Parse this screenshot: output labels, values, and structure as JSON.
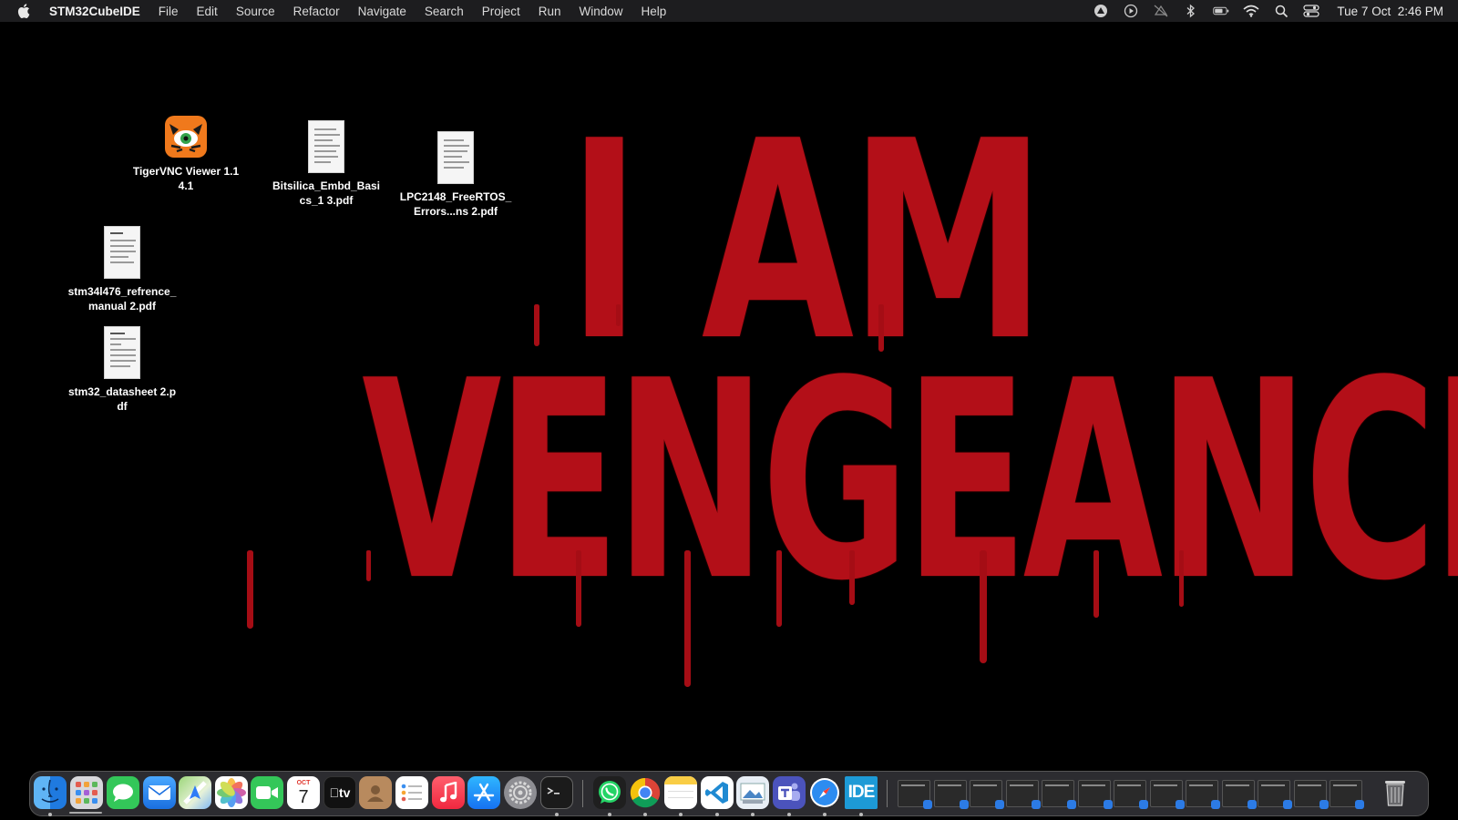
{
  "menubar": {
    "apple_icon": "apple-logo",
    "app_name": "STM32CubeIDE",
    "menus": [
      "File",
      "Edit",
      "Source",
      "Refactor",
      "Navigate",
      "Search",
      "Project",
      "Run",
      "Window",
      "Help"
    ],
    "status_icons": [
      "creative-cloud-icon",
      "play-icon",
      "muted-bell-icon",
      "bluetooth-icon",
      "battery-icon",
      "wifi-icon",
      "spotlight-search-icon",
      "control-center-icon"
    ],
    "clock": {
      "date": "Tue 7 Oct",
      "time": "2:46 PM"
    }
  },
  "wallpaper": {
    "line1": "I AM",
    "line2": "VENGEANCE",
    "color": "#b30f18"
  },
  "desktop": {
    "icons": [
      {
        "label": "TigerVNC Viewer 1.14.1",
        "type": "app",
        "icon": "tigervnc-icon"
      },
      {
        "label": "Bitsilica_Embd_Basics_1 3.pdf",
        "type": "pdf",
        "icon": "pdf-document-icon"
      },
      {
        "label": "LPC2148_FreeRTOS_Errors...ns 2.pdf",
        "type": "pdf",
        "icon": "pdf-document-icon"
      },
      {
        "label": "stm34l476_refrence_manual 2.pdf",
        "type": "pdf",
        "icon": "pdf-document-icon"
      },
      {
        "label": "stm32_datasheet 2.pdf",
        "type": "pdf",
        "icon": "pdf-document-icon"
      }
    ]
  },
  "dock": {
    "apps": [
      {
        "name": "Finder",
        "icon": "finder-icon",
        "running": true
      },
      {
        "name": "Launchpad",
        "icon": "launchpad-icon",
        "running": false
      },
      {
        "name": "Messages",
        "icon": "messages-icon",
        "running": false
      },
      {
        "name": "Mail",
        "icon": "mail-icon",
        "running": false
      },
      {
        "name": "Maps",
        "icon": "maps-icon",
        "running": false
      },
      {
        "name": "Photos",
        "icon": "photos-icon",
        "running": false
      },
      {
        "name": "FaceTime",
        "icon": "facetime-icon",
        "running": false
      },
      {
        "name": "Calendar",
        "icon": "calendar-icon",
        "running": false,
        "month": "OCT",
        "day": "7"
      },
      {
        "name": "TV",
        "icon": "apple-tv-icon",
        "running": false,
        "text": "tv"
      },
      {
        "name": "Contacts",
        "icon": "contacts-icon",
        "running": false
      },
      {
        "name": "Reminders",
        "icon": "reminders-icon",
        "running": false
      },
      {
        "name": "Music",
        "icon": "music-icon",
        "running": false
      },
      {
        "name": "App Store",
        "icon": "app-store-icon",
        "running": false
      },
      {
        "name": "System Settings",
        "icon": "settings-icon",
        "running": false
      },
      {
        "name": "Terminal",
        "icon": "terminal-icon",
        "running": true
      },
      {
        "name": "WhatsApp",
        "icon": "whatsapp-icon",
        "running": true
      },
      {
        "name": "Chrome",
        "icon": "chrome-icon",
        "running": true
      },
      {
        "name": "Notes",
        "icon": "notes-icon",
        "running": true
      },
      {
        "name": "VS Code",
        "icon": "vscode-icon",
        "running": true
      },
      {
        "name": "Preview",
        "icon": "preview-icon",
        "running": true
      },
      {
        "name": "Teams",
        "icon": "teams-icon",
        "running": true
      },
      {
        "name": "Safari",
        "icon": "safari-icon",
        "running": true
      },
      {
        "name": "STM32CubeIDE",
        "icon": "stm32cubeide-icon",
        "running": true,
        "text": "IDE"
      }
    ],
    "minimized_windows": 13,
    "trash": {
      "icon": "trash-icon"
    }
  }
}
